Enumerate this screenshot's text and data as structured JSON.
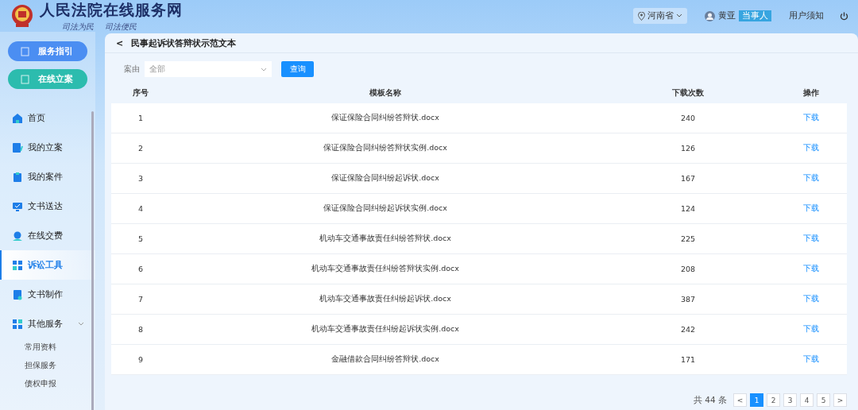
{
  "header": {
    "title": "人民法院在线服务网",
    "slogans": [
      "司法为民",
      "司法便民"
    ],
    "region": "河南省",
    "user": "黄亚",
    "role": "当事人",
    "notice": "用户须知"
  },
  "quick_buttons": [
    {
      "label": "服务指引",
      "color": "#4b8ef2"
    },
    {
      "label": "在线立案",
      "color": "#2cbcae"
    }
  ],
  "sidebar": {
    "items": [
      {
        "label": "首页",
        "selected": false
      },
      {
        "label": "我的立案",
        "selected": false
      },
      {
        "label": "我的案件",
        "selected": false
      },
      {
        "label": "文书送达",
        "selected": false
      },
      {
        "label": "在线交费",
        "selected": false
      },
      {
        "label": "诉讼工具",
        "selected": true
      },
      {
        "label": "文书制作",
        "selected": false
      },
      {
        "label": "其他服务",
        "selected": false,
        "expanded": true,
        "children": [
          {
            "label": "常用资料"
          },
          {
            "label": "担保服务"
          },
          {
            "label": "债权申报"
          }
        ]
      }
    ]
  },
  "page": {
    "back": "<",
    "title": "民事起诉状答辩状示范文本"
  },
  "filter": {
    "label": "案由",
    "value": "全部",
    "button": "查询"
  },
  "table": {
    "columns": [
      "序号",
      "模板名称",
      "下载次数",
      "操作"
    ],
    "rows": [
      {
        "index": "1",
        "name": "保证保险合同纠纷答辩状.docx",
        "downloads": "240",
        "action": "下载"
      },
      {
        "index": "2",
        "name": "保证保险合同纠纷答辩状实例.docx",
        "downloads": "126",
        "action": "下载"
      },
      {
        "index": "3",
        "name": "保证保险合同纠纷起诉状.docx",
        "downloads": "167",
        "action": "下载"
      },
      {
        "index": "4",
        "name": "保证保险合同纠纷起诉状实例.docx",
        "downloads": "124",
        "action": "下载"
      },
      {
        "index": "5",
        "name": "机动车交通事故责任纠纷答辩状.docx",
        "downloads": "225",
        "action": "下载"
      },
      {
        "index": "6",
        "name": "机动车交通事故责任纠纷答辩状实例.docx",
        "downloads": "208",
        "action": "下载"
      },
      {
        "index": "7",
        "name": "机动车交通事故责任纠纷起诉状.docx",
        "downloads": "387",
        "action": "下载"
      },
      {
        "index": "8",
        "name": "机动车交通事故责任纠纷起诉状实例.docx",
        "downloads": "242",
        "action": "下载"
      },
      {
        "index": "9",
        "name": "金融借款合同纠纷答辩状.docx",
        "downloads": "171",
        "action": "下载"
      }
    ]
  },
  "pagination": {
    "total": "共 44 条",
    "prev": "<",
    "next": ">",
    "pages": [
      {
        "label": "1",
        "selected": true
      },
      {
        "label": "2",
        "selected": false
      },
      {
        "label": "3",
        "selected": false
      },
      {
        "label": "4",
        "selected": false
      },
      {
        "label": "5",
        "selected": false
      }
    ]
  }
}
